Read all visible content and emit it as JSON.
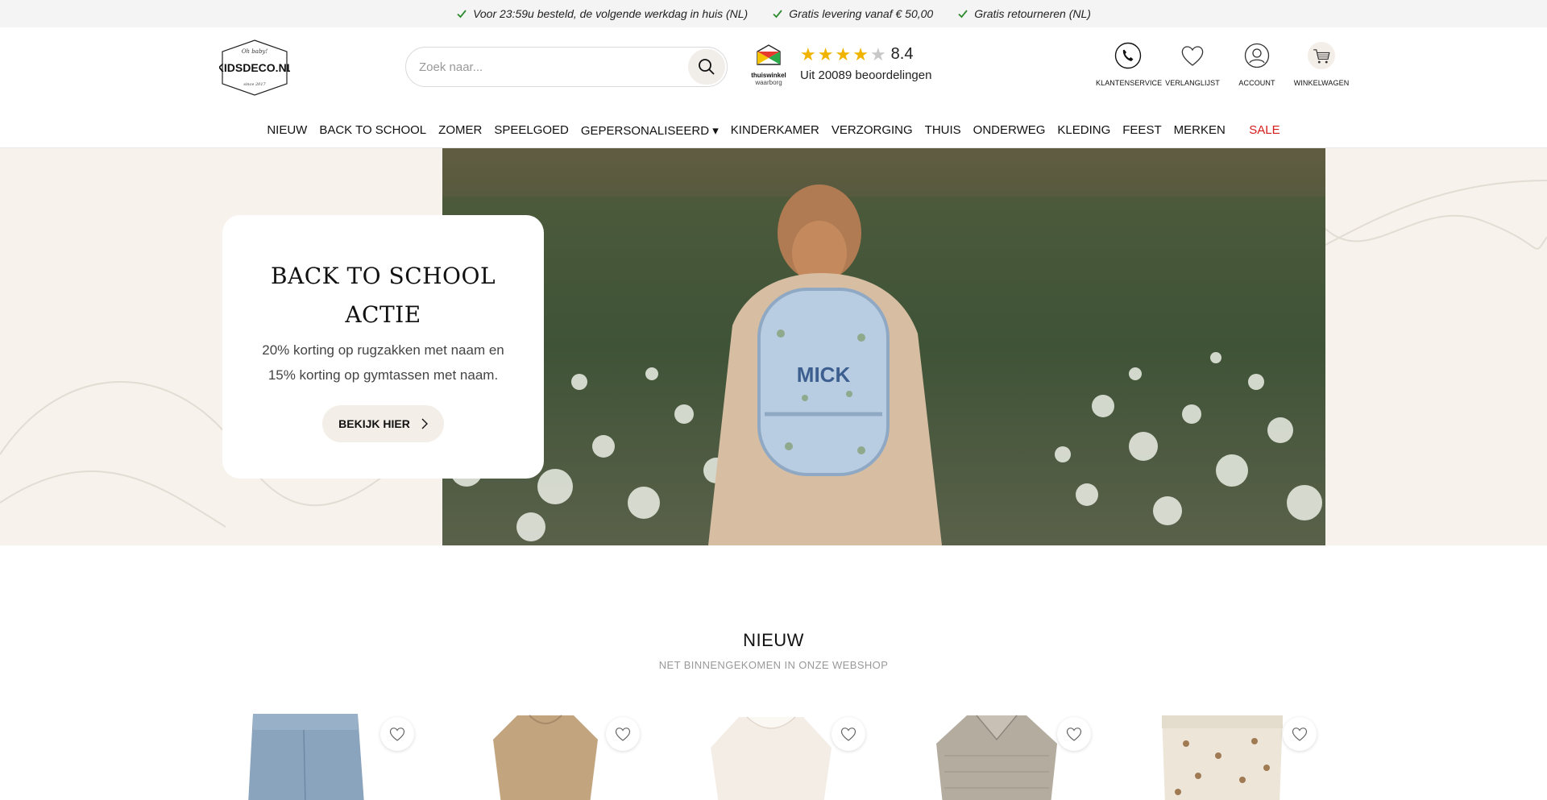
{
  "usp_bar": {
    "items": [
      "Voor 23:59u besteld, de volgende werkdag in huis (NL)",
      "Gratis levering vanaf € 50,00",
      "Gratis retourneren (NL)"
    ],
    "check_color": "#2e8b2e"
  },
  "header": {
    "logo": {
      "brand": "KIDSDECO.NL",
      "tagline": "Oh baby!",
      "since": "since 2017"
    },
    "search": {
      "placeholder": "Zoek naar...",
      "value": ""
    },
    "thuiswinkel": {
      "line1": "thuiswinkel",
      "line2": "waarborg"
    },
    "rating": {
      "stars_filled": 4,
      "stars_total": 5,
      "score": "8.4",
      "reviews": "Uit 20089 beoordelingen"
    },
    "icons": [
      {
        "label": "KLANTENSERVICE",
        "icon": "phone-icon"
      },
      {
        "label": "VERLANGLIJST",
        "icon": "heart-icon"
      },
      {
        "label": "ACCOUNT",
        "icon": "user-icon"
      },
      {
        "label": "WINKELWAGEN",
        "icon": "cart-icon"
      }
    ]
  },
  "nav": {
    "items": [
      "NIEUW",
      "BACK TO SCHOOL",
      "ZOMER",
      "SPEELGOED",
      "GEPERSONALISEERD ▾",
      "KINDERKAMER",
      "VERZORGING",
      "THUIS",
      "ONDERWEG",
      "KLEDING",
      "FEEST",
      "MERKEN"
    ],
    "sale": "SALE",
    "sale_color": "#d41b1b"
  },
  "hero": {
    "title": "BACK TO SCHOOL ACTIE",
    "text": "20% korting op rugzakken met naam en 15% korting op gymtassen met naam.",
    "button": "BEKIJK HIER",
    "backpack_name": "MICK",
    "bg_color": "#f7f2ec"
  },
  "new_section": {
    "title": "NIEUW",
    "subtitle": "NET BINNENGEKOMEN IN ONZE WEBSHOP",
    "products": [
      {
        "icon": "jeans-product-image"
      },
      {
        "icon": "knit-sweater-product-image"
      },
      {
        "icon": "blouse-product-image"
      },
      {
        "icon": "striped-shirt-product-image"
      },
      {
        "icon": "printed-pants-product-image"
      }
    ]
  }
}
